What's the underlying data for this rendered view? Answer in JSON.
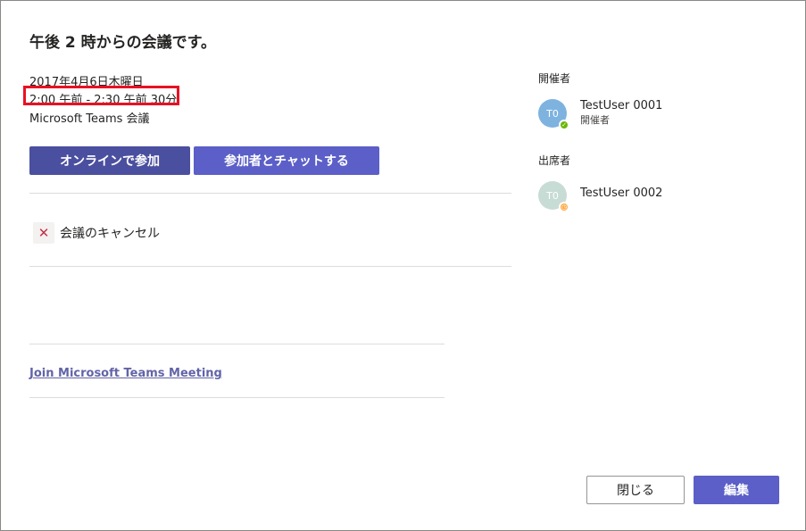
{
  "meeting": {
    "title": "午後 2 時からの会議です。",
    "date": "2017年4月6日木曜日",
    "time": "2:00 午前 - 2:30 午前 30分",
    "type": "Microsoft Teams 会議"
  },
  "actions": {
    "join_online": "オンラインで参加",
    "chat_participants": "参加者とチャットする",
    "cancel_meeting": "会議のキャンセル",
    "join_link": "Join Microsoft Teams Meeting"
  },
  "organizer": {
    "section_label": "開催者",
    "initials": "T0",
    "name": "TestUser 0001",
    "role": "開催者",
    "status": "available",
    "avatar_color": "#7eb3e0",
    "status_color": "#6bb700"
  },
  "attendees": {
    "section_label": "出席者",
    "items": [
      {
        "initials": "T0",
        "name": "TestUser 0002",
        "status": "away",
        "avatar_color": "#c8dcd6",
        "status_color": "#ffaa44"
      }
    ]
  },
  "footer": {
    "close_label": "閉じる",
    "edit_label": "編集"
  },
  "colors": {
    "accent": "#5b5fc7",
    "highlight": "#e81123",
    "cancel_icon": "#c4314b"
  }
}
